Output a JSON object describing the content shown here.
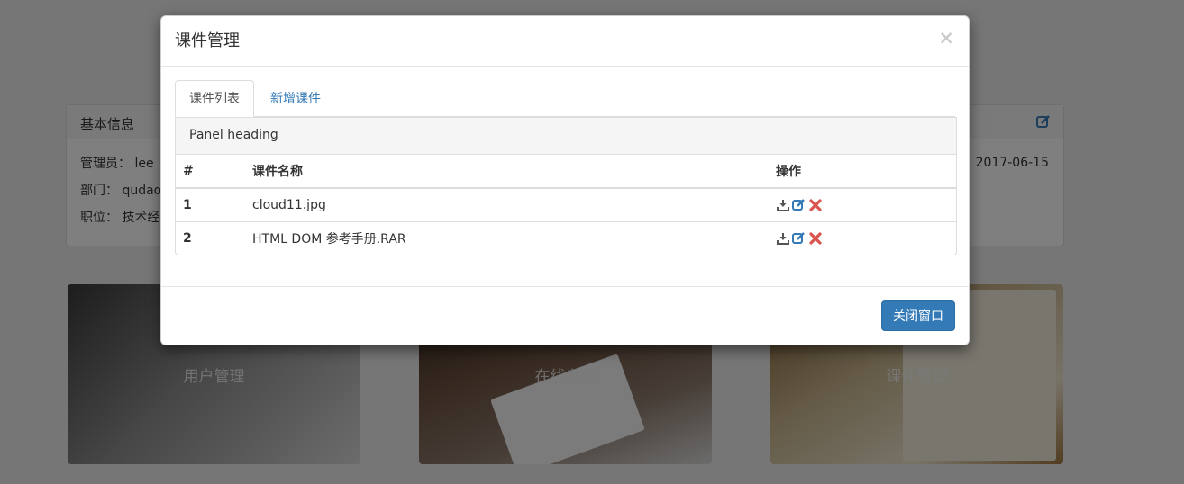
{
  "background": {
    "info_panel": {
      "title": "基本信息",
      "rows": [
        {
          "label": "管理员：",
          "value": "lee"
        },
        {
          "label": "部门：",
          "value": "qudao"
        },
        {
          "label": "职位：",
          "value": "技术经"
        }
      ],
      "date": "2017-06-15"
    },
    "tiles": [
      {
        "label": "用户管理"
      },
      {
        "label": "在线考试"
      },
      {
        "label": "课件管理"
      }
    ]
  },
  "modal": {
    "title": "课件管理",
    "close_symbol": "×",
    "tabs": [
      {
        "label": "课件列表",
        "active": true
      },
      {
        "label": "新增课件",
        "active": false
      }
    ],
    "panel_heading": "Panel heading",
    "table": {
      "headers": [
        "#",
        "课件名称",
        "操作"
      ],
      "rows": [
        {
          "num": "1",
          "name": "cloud11.jpg"
        },
        {
          "num": "2",
          "name": "HTML DOM 参考手册.RAR"
        }
      ]
    },
    "footer": {
      "close_button": "关闭窗口"
    }
  },
  "colors": {
    "primary": "#337ab7",
    "download_icon": "#555555",
    "edit_icon": "#337ab7",
    "delete_icon": "#d9534f"
  },
  "icons": [
    "download-icon",
    "edit-icon",
    "delete-icon",
    "close-icon"
  ]
}
